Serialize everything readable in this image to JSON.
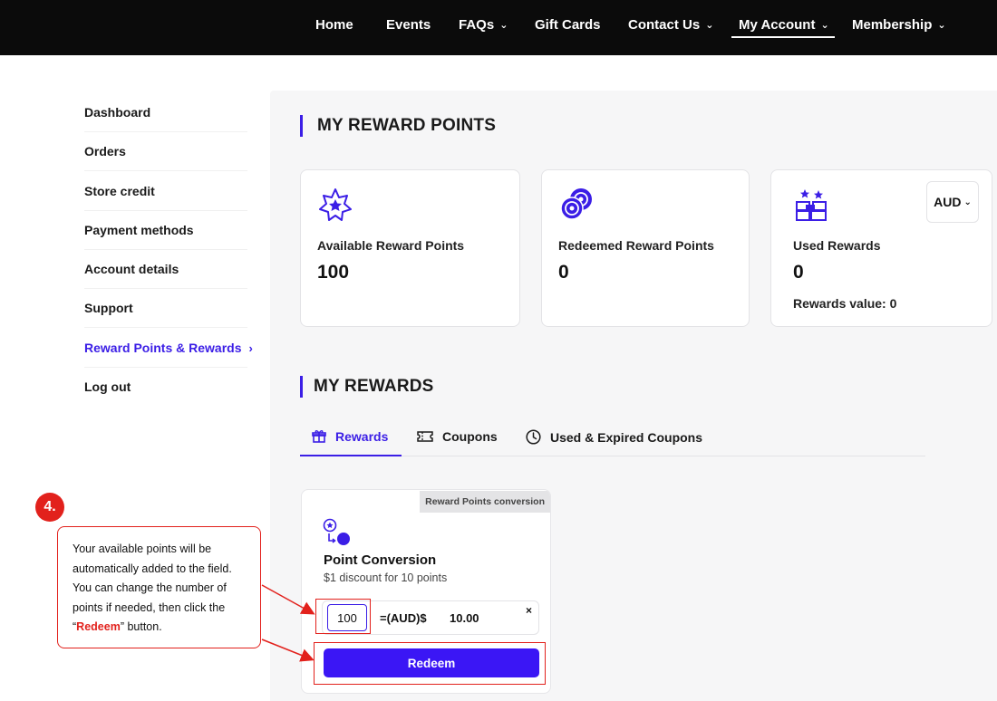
{
  "nav": {
    "items": [
      {
        "label": "Home",
        "has_dropdown": false
      },
      {
        "label": "Events",
        "has_dropdown": false
      },
      {
        "label": "FAQs",
        "has_dropdown": true
      },
      {
        "label": "Gift Cards",
        "has_dropdown": false
      },
      {
        "label": "Contact Us",
        "has_dropdown": true
      },
      {
        "label": "My Account",
        "has_dropdown": true,
        "active": true
      },
      {
        "label": "Membership",
        "has_dropdown": true
      }
    ]
  },
  "sidebar": {
    "items": [
      {
        "label": "Dashboard"
      },
      {
        "label": "Orders"
      },
      {
        "label": "Store credit"
      },
      {
        "label": "Payment methods"
      },
      {
        "label": "Account details"
      },
      {
        "label": "Support"
      },
      {
        "label": "Reward Points & Rewards",
        "active": true
      },
      {
        "label": "Log out"
      }
    ]
  },
  "reward_points": {
    "title": "MY REWARD POINTS",
    "cards": [
      {
        "label": "Available Reward Points",
        "value": "100",
        "icon": "star-badge-icon"
      },
      {
        "label": "Redeemed Reward Points",
        "value": "0",
        "icon": "coins-icon"
      },
      {
        "label": "Used Rewards",
        "value": "0",
        "icon": "gift-boxes-icon",
        "extra": "Rewards value: 0"
      }
    ],
    "currency": "AUD"
  },
  "rewards": {
    "title": "MY REWARDS",
    "tabs": [
      {
        "label": "Rewards",
        "icon": "gift-icon",
        "active": true
      },
      {
        "label": "Coupons",
        "icon": "ticket-icon"
      },
      {
        "label": "Used & Expired Coupons",
        "icon": "clock-icon"
      }
    ]
  },
  "conversion_card": {
    "tag": "Reward Points conversion",
    "title": "Point Conversion",
    "subtitle": "$1 discount for 10 points",
    "points_value": "100",
    "equals_label": "=(AUD)$",
    "amount": "10.00",
    "clear_label": "×",
    "redeem_label": "Redeem"
  },
  "annotation": {
    "step": "4.",
    "text_before": "Your available points will be automatically added to the field. You can change the number of points if needed, then click the “",
    "highlight": "Redeem",
    "text_after": "” button."
  },
  "colors": {
    "accent": "#3b1ee6",
    "button": "#3b16f5",
    "annotation_red": "#e2211c",
    "topbar": "#0b0b0b"
  }
}
